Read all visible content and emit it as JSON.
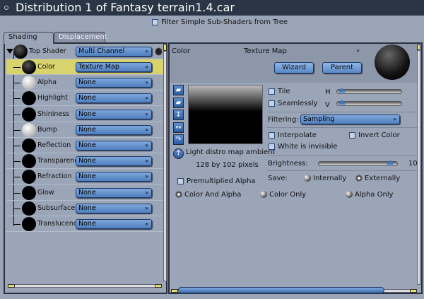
{
  "window": {
    "title": "Distribution 1 of Fantasy terrain1.4.car"
  },
  "filter": {
    "label": "Filter Simple Sub-Shaders from Tree",
    "checked": false
  },
  "tabs": [
    {
      "label": "Shading",
      "active": true
    },
    {
      "label": "Displacement",
      "active": false
    }
  ],
  "tree": {
    "top": {
      "label": "Top Shader",
      "value": "Multi Channel"
    },
    "rows": [
      {
        "label": "Color",
        "value": "Texture Map",
        "ball": "dark",
        "selected": true
      },
      {
        "label": "Alpha",
        "value": "None",
        "ball": "light"
      },
      {
        "label": "Highlight",
        "value": "None",
        "ball": "black"
      },
      {
        "label": "Shininess",
        "value": "None",
        "ball": "black"
      },
      {
        "label": "Bump",
        "value": "None",
        "ball": "light"
      },
      {
        "label": "Reflection",
        "value": "None",
        "ball": "black"
      },
      {
        "label": "Transparency",
        "value": "None",
        "ball": "black"
      },
      {
        "label": "Refraction",
        "value": "None",
        "ball": "black"
      },
      {
        "label": "Glow",
        "value": "None",
        "ball": "black"
      },
      {
        "label": "Subsurface Sc",
        "value": "None",
        "ball": "black"
      },
      {
        "label": "Translucency",
        "value": "None",
        "ball": "black"
      }
    ]
  },
  "editor": {
    "channel": "Color",
    "type": "Texture Map",
    "wizard": "Wizard",
    "parent": "Parent",
    "image_name": "Light distro map ambient",
    "image_size": "128 by 102 pixels",
    "tile": "Tile",
    "seamlessly": "Seamlessly",
    "h": "H",
    "v": "V",
    "h_value": 0.05,
    "v_value": 0.05,
    "filtering_label": "Filtering:",
    "filtering_value": "Sampling",
    "interpolate": "Interpolate",
    "invert": "Invert Color",
    "white_invisible": "White is invisible",
    "brightness_label": "Brightness:",
    "brightness_value": "10",
    "brightness_level": 1.0,
    "save_label": "Save:",
    "internally": "Internally",
    "externally": "Externally",
    "save_selected": "Externally",
    "premultiplied": "Premultiplied Alpha",
    "mode_color_alpha": "Color And Alpha",
    "mode_color_only": "Color Only",
    "mode_alpha_only": "Alpha Only",
    "mode_selected": "Color And Alpha"
  },
  "colors": {
    "titlebar": "#2a3646",
    "background": "#9aa5b8",
    "selection": "#d8d36c",
    "accent": "#5a88c6"
  }
}
